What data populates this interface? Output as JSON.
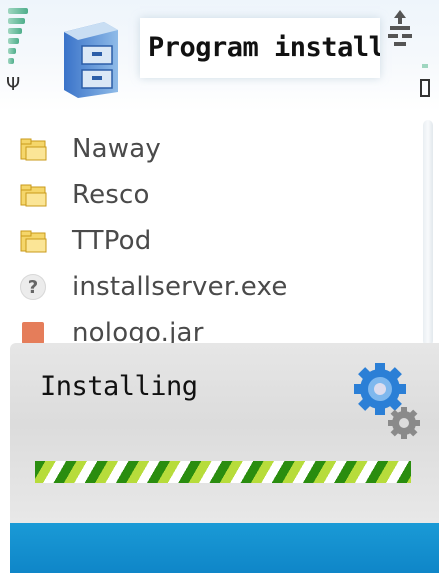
{
  "header": {
    "title": "Program install",
    "app_icon": "file-cabinet-icon",
    "signal_icon": "signal-strength-icon",
    "antenna_icon": "antenna-icon",
    "data_icon": "packet-data-icon",
    "battery_icon": "battery-icon"
  },
  "file_list": {
    "items": [
      {
        "name": "Naway",
        "icon": "folder-icon"
      },
      {
        "name": "Resco",
        "icon": "folder-icon"
      },
      {
        "name": "TTPod",
        "icon": "folder-icon"
      },
      {
        "name": "installserver.exe",
        "icon": "unknown-file-icon",
        "glyph": "?"
      },
      {
        "name": "nologo.jar",
        "icon": "jar-file-icon"
      }
    ]
  },
  "dialog": {
    "text": "Installing",
    "icon": "gears-icon",
    "progress": 1.0
  },
  "softkeys": {
    "left": "",
    "right": ""
  },
  "colors": {
    "softkey_bar": "#1391cf",
    "progress_dark": "#2a8d0f",
    "progress_light": "#b7dc3b",
    "folder": "#f5d66a",
    "gear_blue": "#2b7fd6"
  }
}
